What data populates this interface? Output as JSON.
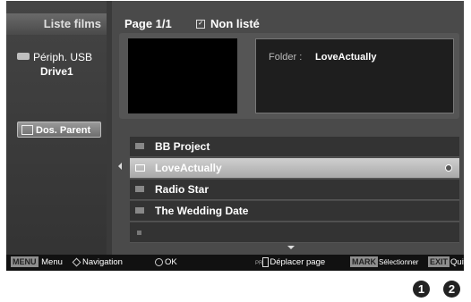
{
  "sidebar": {
    "title": "Liste films",
    "device_line1": "Périph. USB",
    "device_line2": "Drive1",
    "parent_button": "Dos. Parent"
  },
  "header": {
    "page": "Page 1/1",
    "filter": "Non listé"
  },
  "info": {
    "folder_label": "Folder",
    "folder_sep": ":",
    "folder_value": "LoveActually"
  },
  "list": [
    {
      "name": "BB Project",
      "selected": false
    },
    {
      "name": "LoveActually",
      "selected": true
    },
    {
      "name": "Radio Star",
      "selected": false
    },
    {
      "name": "The Wedding Date",
      "selected": false
    },
    {
      "name": "",
      "selected": false
    }
  ],
  "bottom_bar": {
    "menu_key": "MENU",
    "menu_label": "Menu",
    "nav_label": "Navigation",
    "ok_label": "OK",
    "pr_label": "PR",
    "page_label": "Déplacer page",
    "mark_key": "MARK",
    "mark_label": "Sélectionner",
    "exit_key": "EXIT",
    "exit_label": "Quitter"
  },
  "markers": [
    "1",
    "2"
  ]
}
